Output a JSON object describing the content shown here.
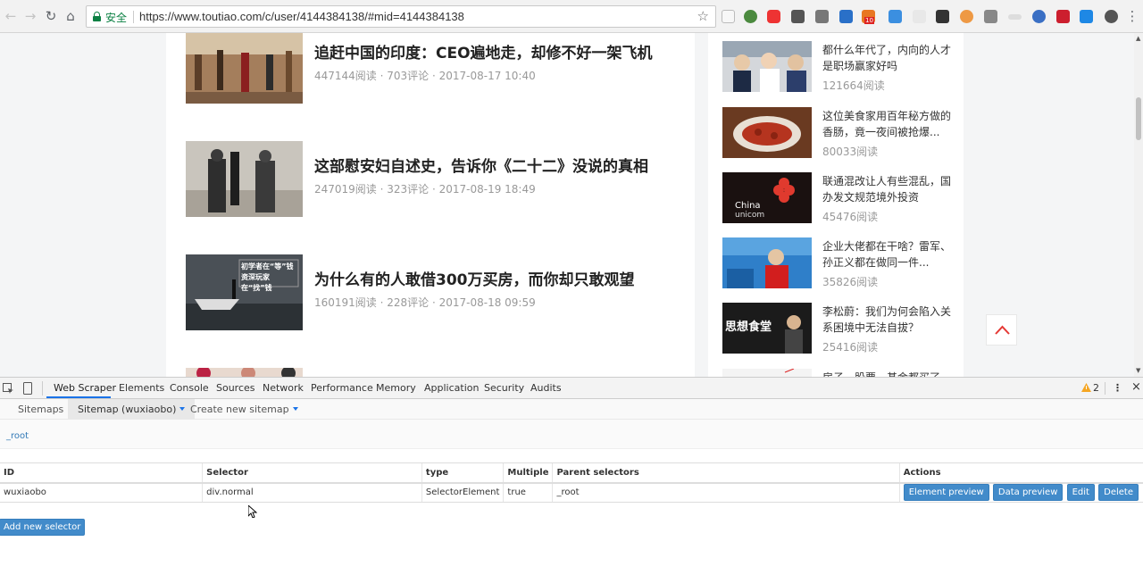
{
  "browser": {
    "secure_label": "安全",
    "url": "https://www.toutiao.com/c/user/4144384138/#mid=4144384138",
    "extension_badge": "10"
  },
  "articles": [
    {
      "title": "追赶中国的印度：CEO遍地走，却修不好一架飞机",
      "meta": "447144阅读 · 703评论 · 2017-08-17 10:40"
    },
    {
      "title": "这部慰安妇自述史，告诉你《二十二》没说的真相",
      "meta": "247019阅读 · 323评论 · 2017-08-19 18:49"
    },
    {
      "title": "为什么有的人敢借300万买房，而你却只敢观望",
      "meta": "160191阅读 · 228评论 · 2017-08-18 09:59",
      "thumb_text": "初学者在“等”钱 资深玩家在“找”钱"
    }
  ],
  "sidebar": [
    {
      "title": "都什么年代了，内向的人才是职场赢家好吗",
      "reads": "121664阅读"
    },
    {
      "title": "这位美食家用百年秘方做的香肠，竟一夜间被抢爆...",
      "reads": "80033阅读"
    },
    {
      "title": "联通混改让人有些混乱，国办发文规范境外投资",
      "reads": "45476阅读"
    },
    {
      "title": "企业大佬都在干啥？雷军、孙正义都在做同一件...",
      "reads": "35826阅读"
    },
    {
      "title": "李松蔚：我们为何会陷入关系困境中无法自拔？",
      "reads": "25416阅读",
      "thumb_text": "思想食堂"
    },
    {
      "title": "房子、股票、基金都买了，为...",
      "reads": ""
    }
  ],
  "devtools": {
    "tabs": [
      "Web Scraper",
      "Elements",
      "Console",
      "Sources",
      "Network",
      "Performance",
      "Memory",
      "Application",
      "Security",
      "Audits"
    ],
    "warning_count": "2",
    "ws_nav": [
      "Sitemaps",
      "Sitemap (wuxiaobo)",
      "Create new sitemap"
    ],
    "breadcrumb": "_root",
    "columns": [
      "ID",
      "Selector",
      "type",
      "Multiple",
      "Parent selectors",
      "Actions"
    ],
    "rows": [
      {
        "id": "wuxiaobo",
        "selector": "div.normal",
        "type": "SelectorElement",
        "multiple": "true",
        "parent": "_root"
      }
    ],
    "actions": [
      "Element preview",
      "Data preview",
      "Edit",
      "Delete"
    ],
    "add_selector": "Add new selector"
  }
}
